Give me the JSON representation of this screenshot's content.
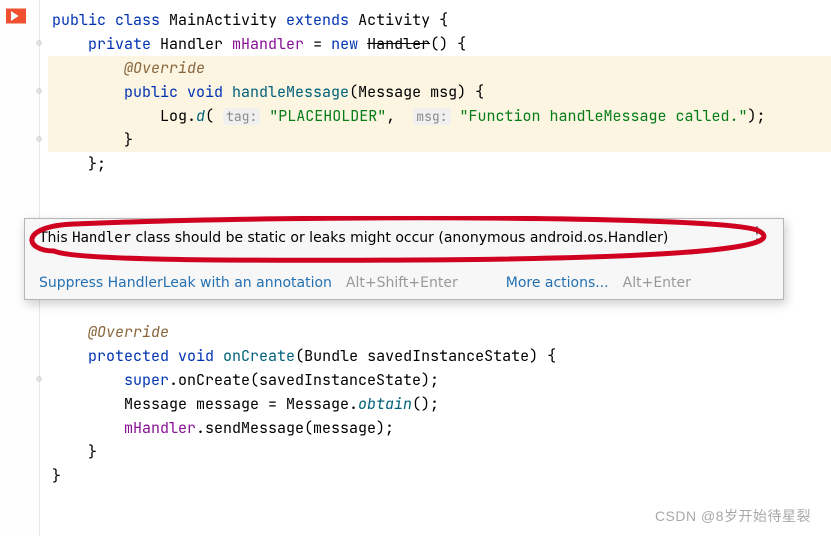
{
  "code": {
    "l1": {
      "k1": "public ",
      "k2": "class ",
      "cls": "MainActivity ",
      "k3": "extends ",
      "sup": "Activity {"
    },
    "l2": {
      "k1": "private ",
      "cls": "Handler ",
      "fld": "mHandler ",
      "eq": "= ",
      "k2": "new ",
      "ctor": "Handler",
      "rest": "() {"
    },
    "l3": {
      "ann": "@Override"
    },
    "l4": {
      "k1": "public ",
      "k2": "void ",
      "m": "handleMessage",
      "params": "(Message msg) {"
    },
    "l5": {
      "pre": "Log.",
      "m": "d",
      "op": "( ",
      "h1": "tag:",
      "s1": " \"PLACEHOLDER\"",
      "c": ",  ",
      "h2": "msg:",
      "s2": " \"Function handleMessage called.\"",
      "end": ");"
    },
    "l6": {
      "brace": "}"
    },
    "l7": {
      "brace": "};"
    },
    "l12": {
      "ann": "@Override"
    },
    "l13": {
      "k1": "protected ",
      "k2": "void ",
      "m": "onCreate",
      "params": "(Bundle savedInstanceState) {"
    },
    "l14": {
      "k1": "super",
      "rest": ".onCreate(savedInstanceState);"
    },
    "l15": {
      "t": "Message message = Message.",
      "m": "obtain",
      "rest": "();"
    },
    "l16": {
      "fld": "mHandler",
      "rest": ".sendMessage(message);"
    },
    "l17": {
      "brace": "}"
    },
    "l18": {
      "brace": "}"
    }
  },
  "tooltip": {
    "msg_a": "This ",
    "msg_b": "Handler",
    "msg_c": " class should be static or leaks might occur (anonymous android.os.Handler)",
    "suppress": "Suppress HandlerLeak with an annotation",
    "suppress_key": "Alt+Shift+Enter",
    "more": "More actions...",
    "more_key": "Alt+Enter"
  },
  "watermark": "CSDN @8岁开始待星裂"
}
